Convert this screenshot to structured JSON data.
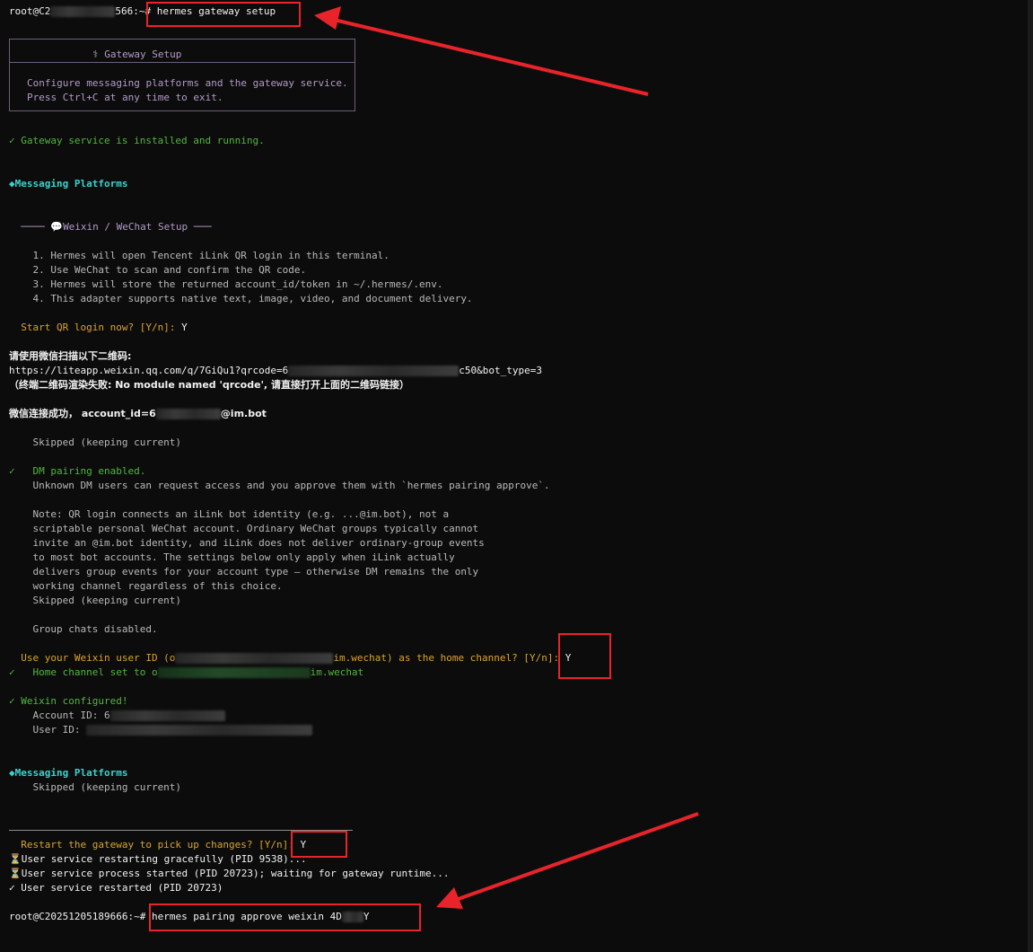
{
  "terminal": {
    "prompt_user_1": "root@C2",
    "prompt_rest_1": "566:~# ",
    "command_1": "hermes gateway setup",
    "box_title": "⚕ Gateway Setup",
    "box_line_1": "Configure messaging platforms and the gateway service.",
    "box_line_2": "Press Ctrl+C at any time to exit.",
    "service_status": "✓ Gateway service is installed and running.",
    "section_messaging_1": "◆Messaging Platforms",
    "weixin_header_pre": "  ──── ",
    "weixin_header_icon": "💬",
    "weixin_header_text": "Weixin / WeChat Setup ───",
    "step_1": "    1. Hermes will open Tencent iLink QR login in this terminal.",
    "step_2": "    2. Use WeChat to scan and confirm the QR code.",
    "step_3": "    3. Hermes will store the returned account_id/token in ~/.hermes/.env.",
    "step_4": "    4. This adapter supports native text, image, video, and document delivery.",
    "start_qr_prompt": "  Start QR login now? [Y/n]: ",
    "start_qr_answer": "Y",
    "scan_label": "请使用微信扫描以下二维码:",
    "url_start": "https://liteapp.weixin.qq.com/q/7GiQu1?qrcode=6",
    "url_end": "c50&bot_type=3",
    "qr_render_fail": "（终端二维码渲染失败: No module named 'qrcode', 请直接打开上面的二维码链接）",
    "connect_success_pre": "微信连接成功， account_id=6",
    "connect_success_post": "@im.bot",
    "skipped_1": "    Skipped (keeping current)",
    "dm_pairing": "✓   DM pairing enabled.",
    "dm_unknown": "    Unknown DM users can request access and you approve them with `hermes pairing approve`.",
    "note_1": "    Note: QR login connects an iLink bot identity (e.g. ...@im.bot), not a",
    "note_2": "    scriptable personal WeChat account. Ordinary WeChat groups typically cannot",
    "note_3": "    invite an @im.bot identity, and iLink does not deliver ordinary-group events",
    "note_4": "    to most bot accounts. The settings below only apply when iLink actually",
    "note_5": "    delivers group events for your account type — otherwise DM remains the only",
    "note_6": "    working channel regardless of this choice.",
    "skipped_2": "    Skipped (keeping current)",
    "group_disabled": "    Group chats disabled.",
    "home_prompt_pre": "  Use your Weixin user ID (o",
    "home_prompt_post": "im.wechat) as the home channel? [Y/n]: ",
    "home_answer": "Y",
    "home_set_pre": "✓   Home channel set to o",
    "home_set_post": "im.wechat",
    "weixin_configured": "✓ Weixin configured!",
    "account_id_label": "    Account ID: 6",
    "user_id_label": "    User ID: ",
    "section_messaging_2": "◆Messaging Platforms",
    "skipped_3": "    Skipped (keeping current)",
    "restart_prompt": "  Restart the gateway to pick up changes? [Y/n]: ",
    "restart_answer": "Y",
    "restarting": "⏳User service restarting gracefully (PID 9538)...",
    "process_started": "⏳User service process started (PID 20723); waiting for gateway runtime...",
    "restarted": "✓ User service restarted (PID 20723)",
    "prompt_2": "root@C20251205189666:~# ",
    "command_2_pre": "hermes pairing approve weixin 4D",
    "command_2_post": "Y"
  },
  "colors": {
    "background": "#0c0c0c",
    "annotation_red": "#e8242a",
    "success_green": "#50b83c",
    "prompt_yellow": "#d9a52a",
    "section_cyan": "#3ad3cf",
    "box_purple": "#b49ac8"
  }
}
